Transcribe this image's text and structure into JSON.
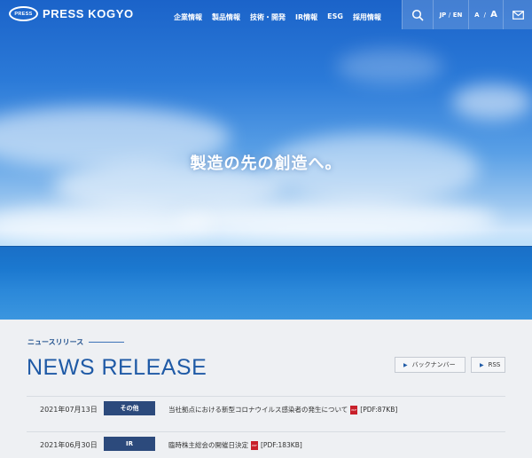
{
  "header": {
    "logo_mark": "PRESS",
    "logo_text": "PRESS KOGYO",
    "nav": [
      "企業情報",
      "製品情報",
      "技術・開発",
      "IR情報",
      "ESG",
      "採用情報"
    ],
    "lang_jp": "JP",
    "lang_sep": "/",
    "lang_en": "EN",
    "size_small": "A",
    "size_sep": "/",
    "size_large": "A"
  },
  "hero": {
    "catchphrase": "製造の先の創造へ。"
  },
  "news": {
    "subtitle": "ニュースリリース",
    "title": "NEWS RELEASE",
    "backnumber_label": "バックナンバー",
    "rss_label": "RSS",
    "items": [
      {
        "date": "2021年07月13日",
        "category": "その他",
        "title": "当社拠点における新型コロナウイルス感染者の発生について",
        "pdf": "[PDF:87KB]"
      },
      {
        "date": "2021年06月30日",
        "category": "IR",
        "title": "臨時株主総会の開催日決定",
        "pdf": "[PDF:183KB]"
      }
    ]
  },
  "colors": {
    "accent": "#1f5aa6",
    "category_bg": "#2c4a7c",
    "pdf_red": "#c8202b"
  }
}
